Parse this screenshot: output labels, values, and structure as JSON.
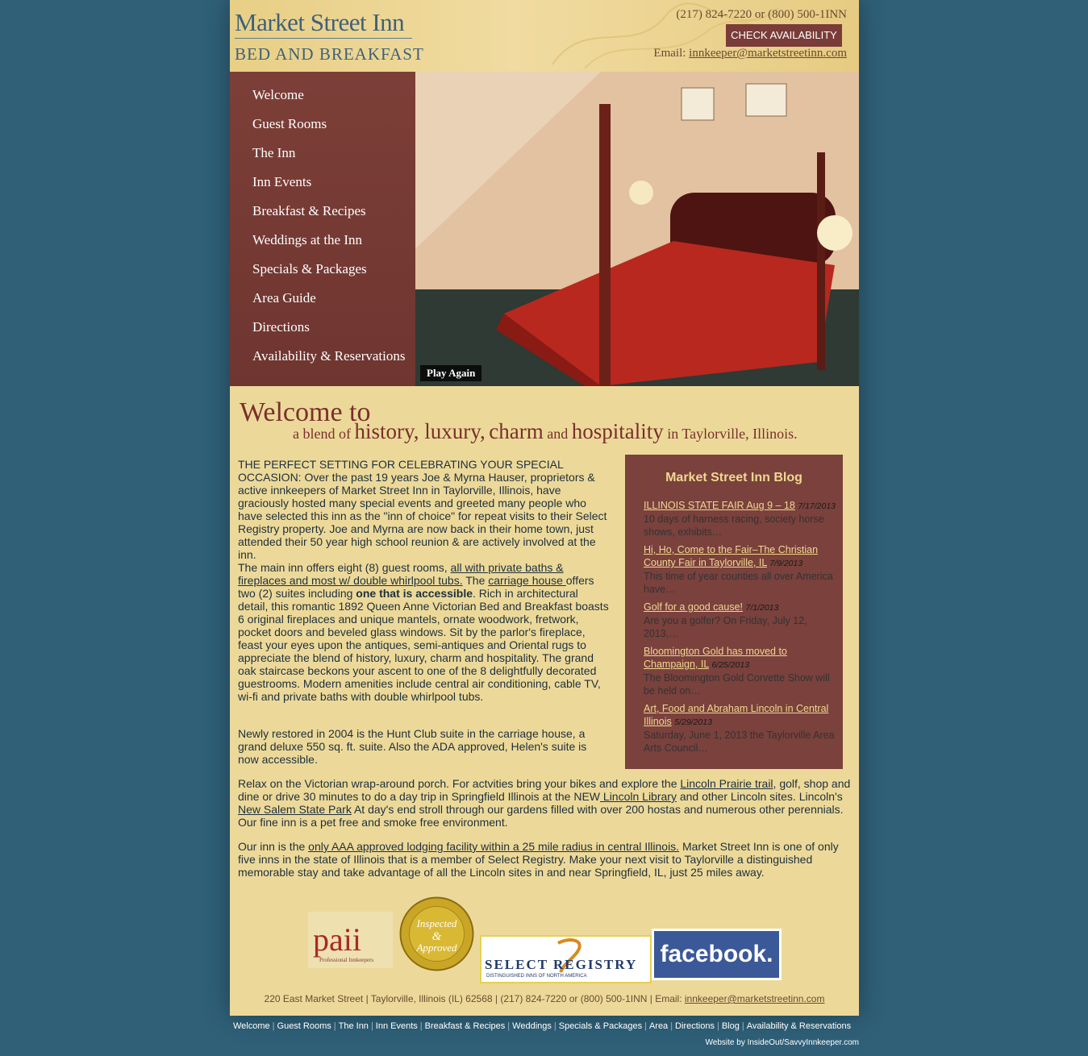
{
  "header": {
    "logo_title": "Market Street Inn",
    "logo_subtitle": "BED AND BREAKFAST",
    "phone": "(217) 824-7220 or (800) 500-1INN",
    "check_button": "CHECK AVAILABILITY",
    "email_label": "Email:",
    "email": "innkeeper@marketstreetinn.com"
  },
  "nav": [
    "Welcome",
    "Guest Rooms",
    "The Inn",
    "Inn Events",
    "Breakfast & Recipes",
    "Weddings at the Inn",
    "Specials & Packages",
    "Area Guide",
    "Directions",
    "Availability & Reservations"
  ],
  "hero": {
    "play_again": "Play Again"
  },
  "welcome": {
    "line1": "Welcome to",
    "a_blend_of": "a blend of",
    "history_luxury": "history, luxury,",
    "charm": "charm",
    "and": "and",
    "hospitality": "hospitality",
    "in_taylorville": "in Taylorville, Illinois."
  },
  "body": {
    "p1": "THE PERFECT SETTING FOR CELEBRATING YOUR SPECIAL OCCASION:  Over the past 19 years Joe & Myrna Hauser, proprietors & active innkeepers of Market Street Inn in Taylorville, Illinois, have graciously hosted many special events and greeted many people who have selected this  inn as the \"inn of choice\"  for repeat visits to their Select Registry property.  Joe and Myrna are now back in their home town, just attended their 50 year high school reunion & are actively involved at the inn.",
    "p2_a": " The main inn offers eight (8) guest rooms, ",
    "p2_link1": "all with private baths &  fireplaces and most w/ double whirlpool tubs.",
    "p2_b": "  The ",
    "p2_link2": "carriage house ",
    "p2_c": "offers two (2) suites including ",
    "p2_bold": "one that is accessible",
    "p2_d": ".  Rich in architectural detail, this romantic 1892 Queen Anne Victorian Bed and Breakfast boasts 6 original fireplaces and unique mantels, ornate woodwork, fretwork, pocket doors and beveled glass windows. Sit by the parlor's fireplace, feast your eyes upon the antiques, semi-antiques and Oriental rugs to appreciate the blend of history, luxury, charm and hospitality. The grand oak staircase beckons your ascent to one of the 8 delightfully decorated guestrooms. Modern amenities include central air conditioning, cable TV,  wi-fi and private baths with double whirlpool tubs.",
    "p3": " Newly restored in 2004 is the Hunt Club suite in the carriage house, a grand deluxe 550 sq. ft. suite.  Also the ADA approved, Helen's suite is now accessible.",
    "p4_a": "Relax on the Victorian wrap-around porch. For actvities bring your bikes and explore the ",
    "p4_link1": "Lincoln Prairie trail",
    "p4_b": ", golf, shop and dine  or drive 30 minutes to do a day trip in Springfield Illinois at the NEW",
    "p4_link2": " Lincoln Library",
    "p4_c": " and other Lincoln sites. Lincoln's ",
    "p4_link3": "New Salem State Park",
    "p4_d": "  At day's end stroll through our gardens filled with over 200 hostas and numerous other perennials.  Our fine inn is a pet free and smoke free environment.",
    "p5_a": "Our inn is the ",
    "p5_link": "only AAA approved lodging facility within a 25 mile radius in central Illinois.",
    "p5_b": "   Market Street Inn is one of only five inns in the state of Illinois that is a member of Select Registry.   Make your next visit to Taylorville a distinguished memorable stay and take advantage of all the Lincoln sites in and near Springfield, IL, just 25 miles away."
  },
  "blog": {
    "title": "Market Street Inn Blog",
    "entries": [
      {
        "title": "ILLINOIS STATE FAIR Aug 9 – 18",
        "date": "7/17/2013",
        "excerpt": "10 days of harness racing, society horse shows, exhibits…"
      },
      {
        "title": "Hi, Ho, Come to the Fair–The Christian County Fair in Taylorville, IL",
        "date": "7/9/2013",
        "excerpt": "This time of year counties all over America have…"
      },
      {
        "title": "Golf for a good cause!",
        "date": "7/1/2013",
        "excerpt": "Are you a golfer? On Friday, July 12, 2013,…"
      },
      {
        "title": "Bloomington Gold has moved to Champaign, IL",
        "date": "6/25/2013",
        "excerpt": "The Bloomington Gold Corvette Show will be held on…"
      },
      {
        "title": "Art, Food and Abraham Lincoln in Central Illinois",
        "date": "5/29/2013",
        "excerpt": "Saturday, June 1, 2013 the Taylorville Area Arts Council…"
      }
    ]
  },
  "logos": {
    "paii": "paii",
    "paii_sub": "Professional Innkeepers",
    "badge_line1": "Inspected",
    "badge_line2": "&",
    "badge_line3": "Approved",
    "select_registry": "SELECT REGISTRY",
    "select_registry_sub": "DISTINGUISHED INNS OF NORTH AMERICA",
    "facebook": "facebook."
  },
  "address": {
    "text": "220 East Market Street | Taylorville, Illinois (IL) 62568 | (217) 824-7220 or (800) 500-1INN | Email: ",
    "email": "innkeeper@marketstreetinn.com"
  },
  "footer_nav": [
    "Welcome",
    "Guest Rooms",
    "The Inn",
    "Inn Events",
    "Breakfast & Recipes",
    "Weddings",
    "Specials & Packages",
    "Area",
    "Directions",
    "Blog",
    "Availability & Reservations"
  ],
  "credit": "Website by InsideOut/SavvyInnkeeper.com",
  "colors": {
    "background": "#2f6078",
    "page": "#ecd99a",
    "nav": "#7c3f38",
    "accent": "#7a2f2c",
    "link_gold": "#f2d88f"
  }
}
